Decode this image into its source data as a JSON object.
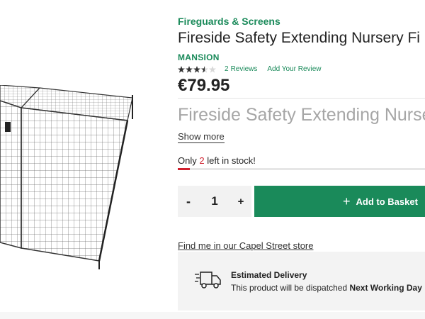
{
  "product": {
    "image_alt": "Fireguard mesh screen",
    "category": "Fireguards & Screens",
    "title": "Fireside Safety Extending Nursery Fi",
    "brand": "MANSION",
    "rating": {
      "stars": 3.5,
      "max_stars": 5,
      "count": "2",
      "count_label": "Reviews",
      "add_review": "Add Your Review"
    },
    "price": "€79.95",
    "description_preview": "Fireside Safety Extending Nurse",
    "show_more": "Show more"
  },
  "stock": {
    "prefix": "Only",
    "count": "2",
    "suffix": "left in stock!",
    "level": 0.05
  },
  "purchase": {
    "minus": "-",
    "quantity": "1",
    "plus": "+",
    "add_icon": "+",
    "add_label": "Add to Basket"
  },
  "store": {
    "find_label": "Find me in our Capel Street store"
  },
  "delivery": {
    "title": "Estimated Delivery",
    "text_prefix": "This product will be dispatched",
    "text_bold": "Next Working Day"
  },
  "colors": {
    "brand_green": "#1a8a5a",
    "stock_red": "#d0202e"
  }
}
